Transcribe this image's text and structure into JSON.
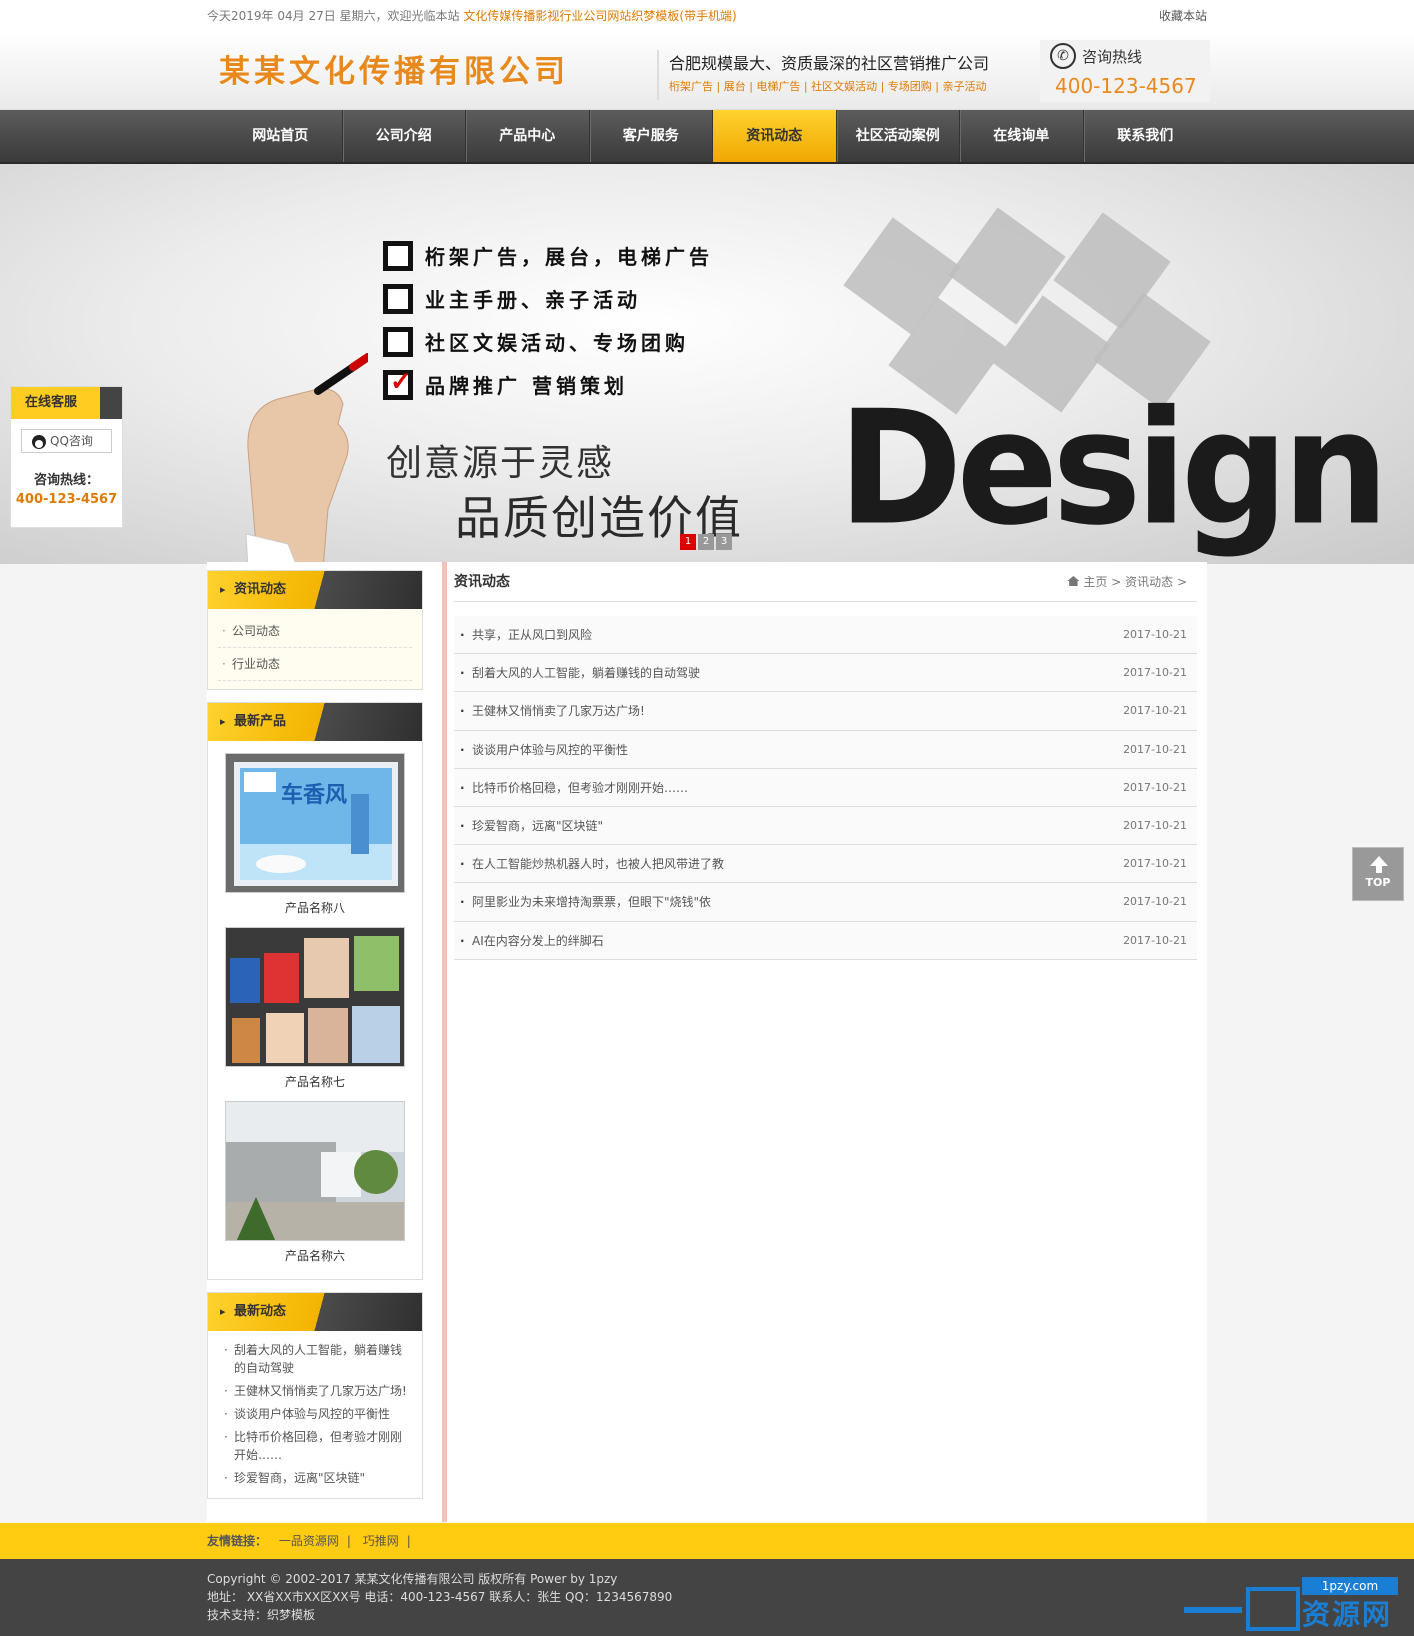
{
  "topbar": {
    "welcome": "今天2019年 04月 27日 星期六，欢迎光临本站",
    "site_link": "文化传媒传播影视行业公司网站织梦模板(带手机端)",
    "favorite": "收藏本站"
  },
  "header": {
    "logo": "某某文化传播有限公司",
    "slogan_main": "合肥规模最大、资质最深的社区营销推广公司",
    "slogan_sub": "桁架广告 | 展台 | 电梯广告 | 社区文娱活动 | 专场团购 | 亲子活动",
    "hotline_label": "咨询热线",
    "hotline_number": "400-123-4567"
  },
  "nav": {
    "items": [
      "网站首页",
      "公司介绍",
      "产品中心",
      "客户服务",
      "资讯动态",
      "社区活动案例",
      "在线询单",
      "联系我们"
    ],
    "active": "资讯动态"
  },
  "banner": {
    "checks": [
      "桁架广告，展台，电梯广告",
      "业主手册、亲子活动",
      "社区文娱活动、专场团购",
      "品牌推广 营销策划"
    ],
    "line1": "创意源于灵感",
    "line2": "品质创造价值",
    "design_word": "Design",
    "pages": [
      "1",
      "2",
      "3"
    ]
  },
  "kefu": {
    "title": "在线客服",
    "qq_label": "QQ咨询",
    "hotline_label": "咨询热线：",
    "hotline_number": "400-123-4567"
  },
  "sidebar": {
    "categories": {
      "title": "资讯动态",
      "items": [
        "公司动态",
        "行业动态"
      ]
    },
    "products": {
      "title": "最新产品",
      "items": [
        "产品名称八",
        "产品名称七",
        "产品名称六"
      ]
    },
    "latest_news": {
      "title": "最新动态",
      "items": [
        "刮着大风的人工智能，躺着赚钱的自动驾驶",
        "王健林又悄悄卖了几家万达广场!",
        "谈谈用户体验与风控的平衡性",
        "比特币价格回稳，但考验才刚刚开始……",
        "珍爱智商，远离\"区块链\""
      ]
    }
  },
  "content": {
    "title": "资讯动态",
    "breadcrumb": {
      "home": "主页",
      "sep": ">",
      "current": "资讯动态"
    },
    "articles": [
      {
        "title": "共享，正从风口到风险",
        "date": "2017-10-21"
      },
      {
        "title": "刮着大风的人工智能，躺着赚钱的自动驾驶",
        "date": "2017-10-21"
      },
      {
        "title": "王健林又悄悄卖了几家万达广场!",
        "date": "2017-10-21"
      },
      {
        "title": "谈谈用户体验与风控的平衡性",
        "date": "2017-10-21"
      },
      {
        "title": "比特币价格回稳，但考验才刚刚开始……",
        "date": "2017-10-21"
      },
      {
        "title": "珍爱智商，远离\"区块链\"",
        "date": "2017-10-21"
      },
      {
        "title": "在人工智能炒热机器人时，也被人把风带进了教",
        "date": "2017-10-21"
      },
      {
        "title": "阿里影业为未来增持淘票票，但眼下\"烧钱\"依",
        "date": "2017-10-21"
      },
      {
        "title": "AI在内容分发上的绊脚石",
        "date": "2017-10-21"
      }
    ]
  },
  "to_top": "TOP",
  "friend_links": {
    "label": "友情链接：",
    "items": [
      "一品资源网",
      "巧推网"
    ]
  },
  "footer": {
    "copyright": "Copyright © 2002-2017 某某文化传播有限公司 版权所有 Power by 1pzy",
    "address": "地址： XX省XX市XX区XX号  电话：400-123-4567  联系人：张生    QQ：1234567890",
    "support": "技术支持：织梦模板",
    "brand_url": "1pzy.com",
    "brand_name": "资源网"
  },
  "colors": {
    "accent": "#ffcc11",
    "orange": "#e8891e",
    "nav_bg": "#444444",
    "footer_bg": "#444444"
  }
}
